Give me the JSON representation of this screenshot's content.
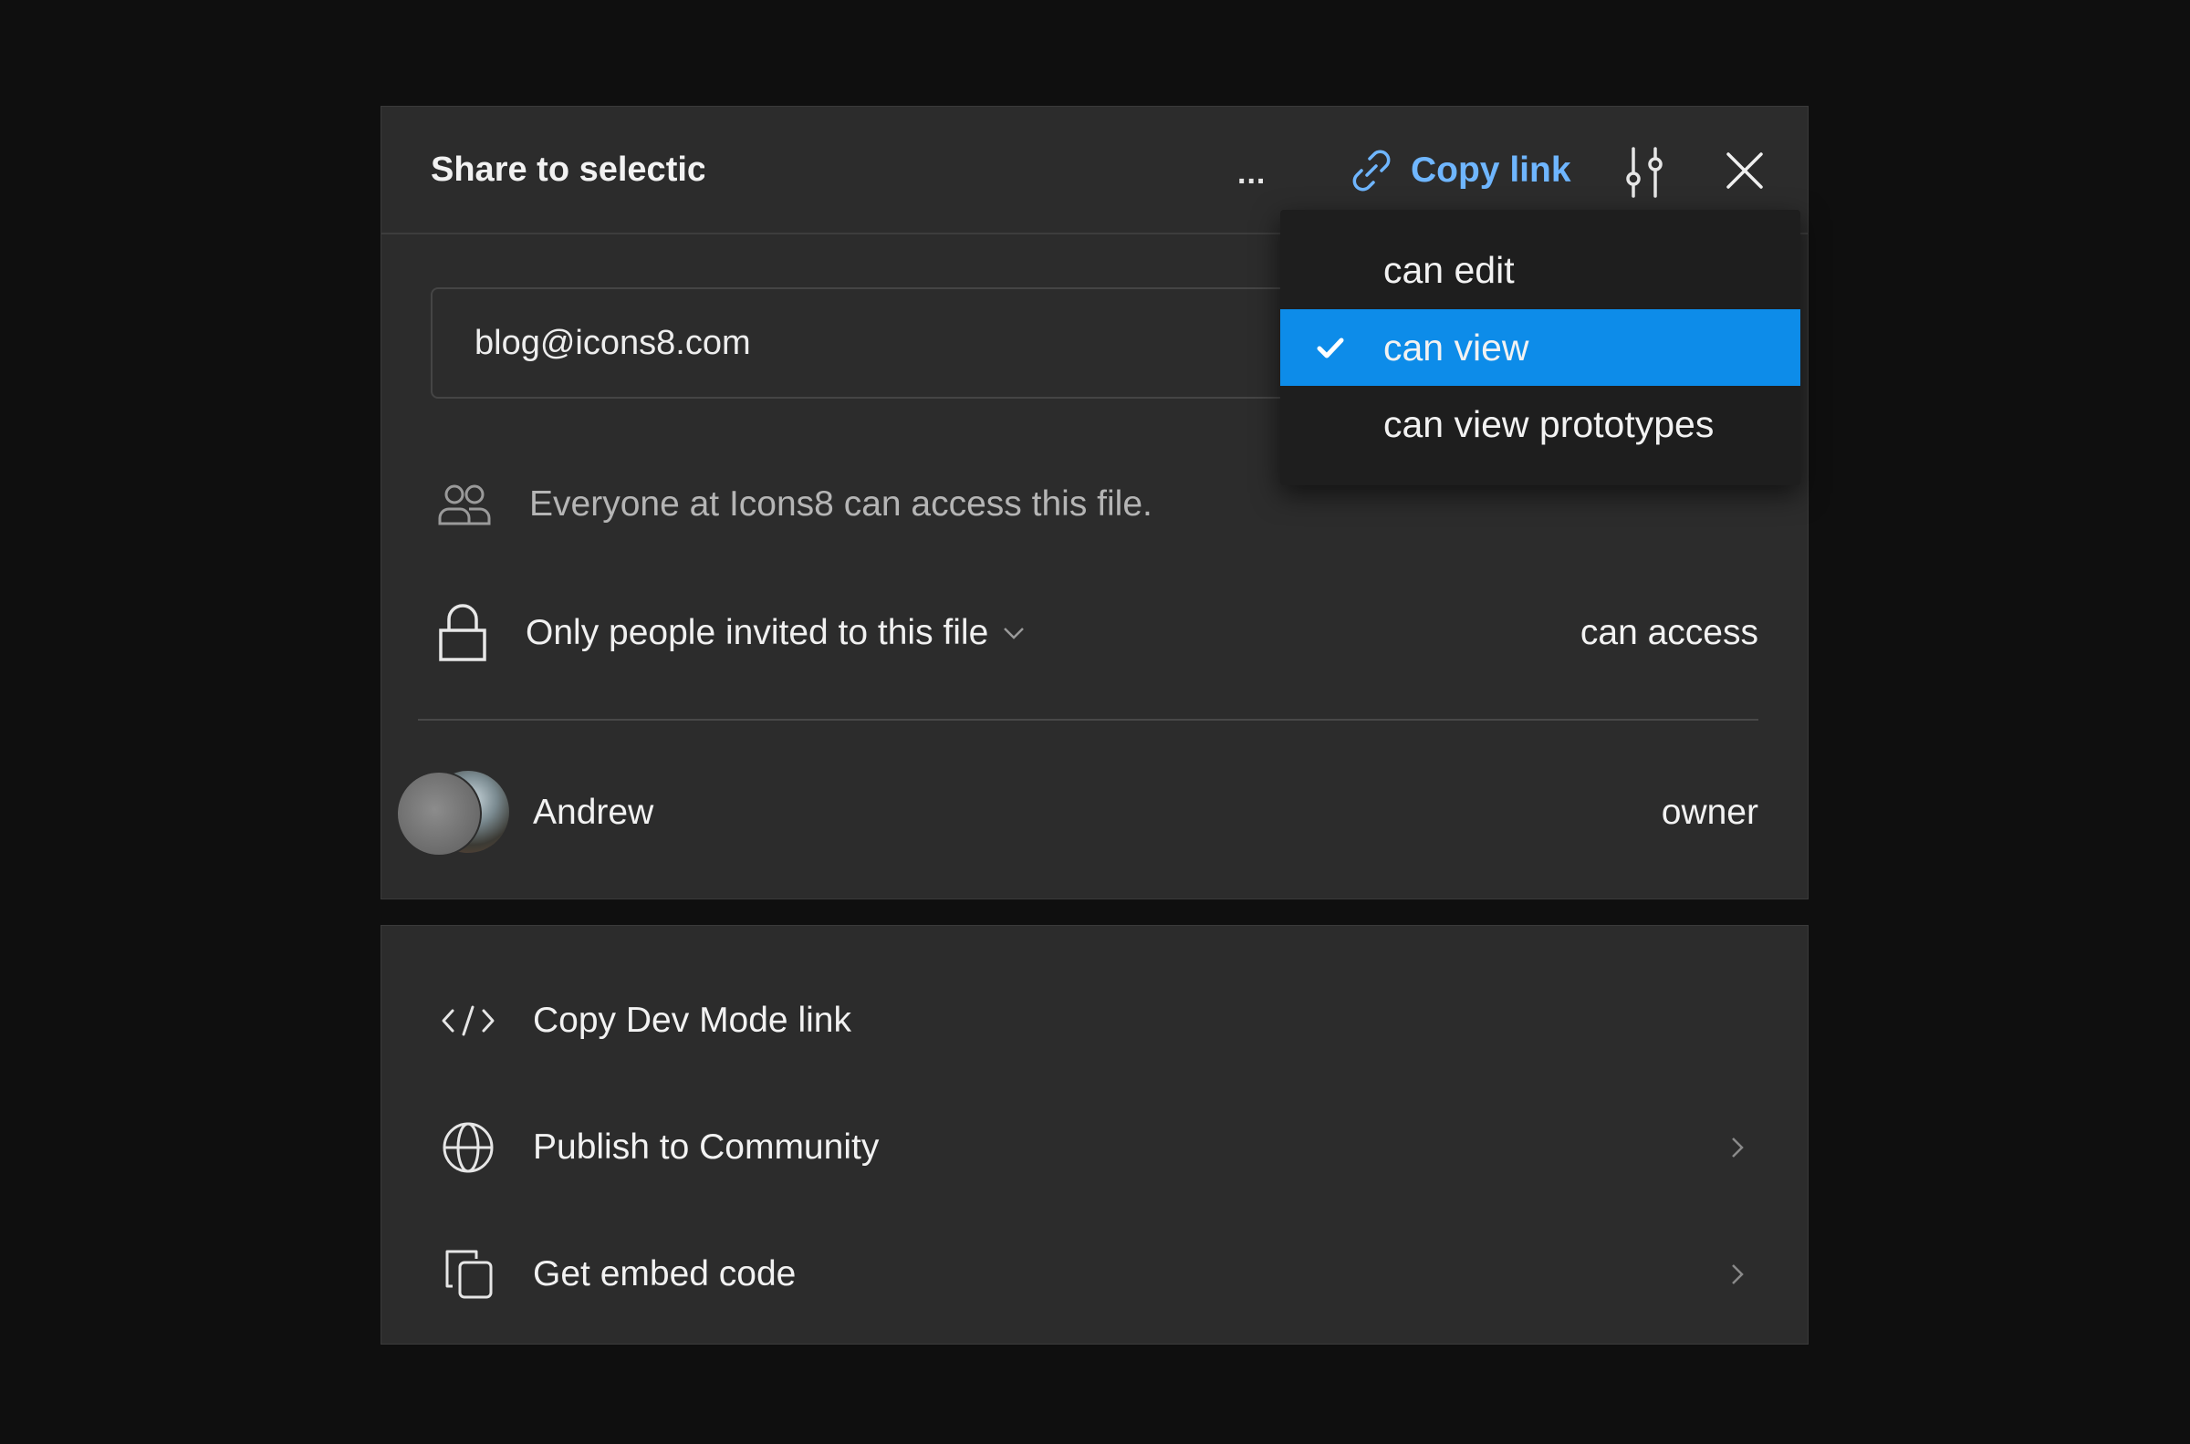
{
  "header": {
    "title": "Share to selectic",
    "more_label": "...",
    "copy_link_label": "Copy link"
  },
  "invite": {
    "email_value": "blog@icons8.com"
  },
  "org_access": {
    "text": "Everyone at Icons8 can access this file."
  },
  "link_access": {
    "scope_label": "Only people invited to this file",
    "permission_label": "can access"
  },
  "members": [
    {
      "name": "Andrew",
      "role": "owner"
    }
  ],
  "permission_menu": {
    "options": [
      "can edit",
      "can view",
      "can view prototypes"
    ],
    "selected": "can view"
  },
  "actions": {
    "items": [
      {
        "label": "Copy Dev Mode link",
        "icon": "code-icon",
        "has_chevron": false
      },
      {
        "label": "Publish to Community",
        "icon": "globe-icon",
        "has_chevron": true
      },
      {
        "label": "Get embed code",
        "icon": "copy-icon",
        "has_chevron": true
      }
    ]
  },
  "colors": {
    "accent_blue": "#0d8ce9",
    "link_blue": "#6fb6ff",
    "panel_bg": "#2c2c2c",
    "menu_bg": "#1e1e1e"
  }
}
